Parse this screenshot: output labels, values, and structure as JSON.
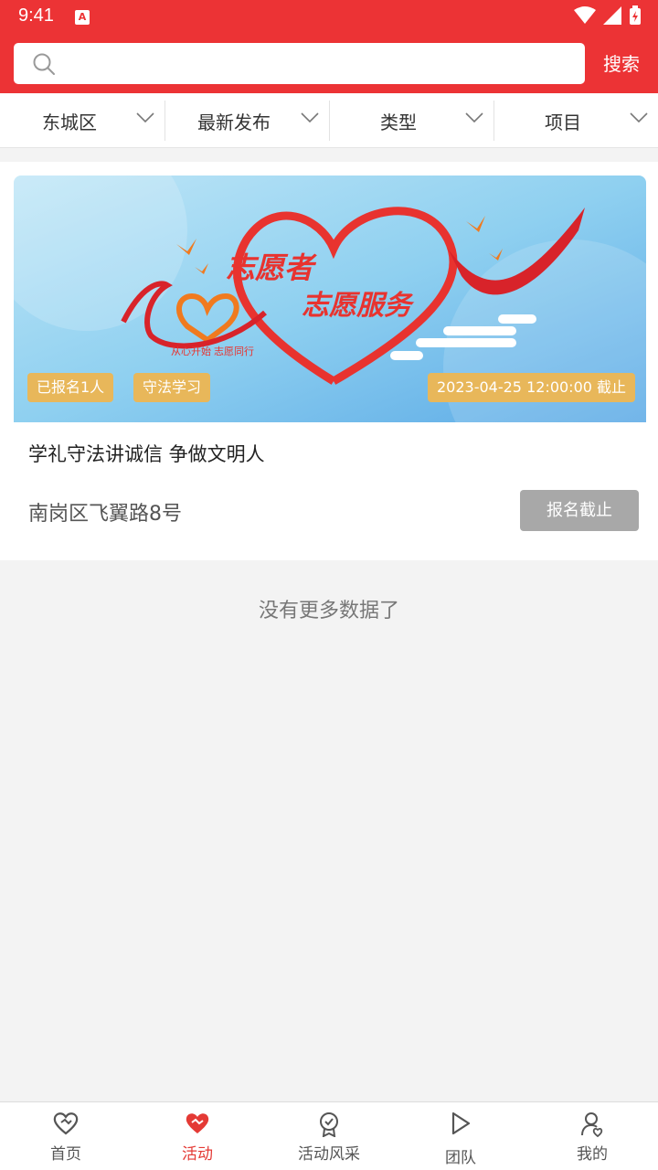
{
  "status_bar": {
    "time": "9:41"
  },
  "search": {
    "placeholder": "",
    "button_label": "搜索"
  },
  "filters": [
    {
      "label": "东城区"
    },
    {
      "label": "最新发布"
    },
    {
      "label": "类型"
    },
    {
      "label": "项目"
    }
  ],
  "event": {
    "banner_heading_1": "志愿者",
    "banner_heading_2": "志愿服务",
    "banner_slogan": "从心开始 志愿同行",
    "registered_tag": "已报名1人",
    "category_tag": "守法学习",
    "deadline_tag": "2023-04-25 12:00:00 截止",
    "title": "学礼守法讲诚信 争做文明人",
    "address": "南岗区飞翼路8号",
    "signup_button": "报名截止"
  },
  "list_footer": {
    "message": "没有更多数据了"
  },
  "tab_bar": {
    "active_index": 1,
    "active_color": "#e43a35",
    "items": [
      {
        "label": "首页",
        "icon": "heart-outline-icon"
      },
      {
        "label": "活动",
        "icon": "heart-hands-icon"
      },
      {
        "label": "活动风采",
        "icon": "award-badge-icon"
      },
      {
        "label": "团队",
        "icon": "play-icon"
      },
      {
        "label": "我的",
        "icon": "user-heart-icon"
      }
    ]
  },
  "colors": {
    "brand_red": "#ec3335",
    "tag_gold": "#e8b75a",
    "disabled_button": "#a8a8a8"
  }
}
